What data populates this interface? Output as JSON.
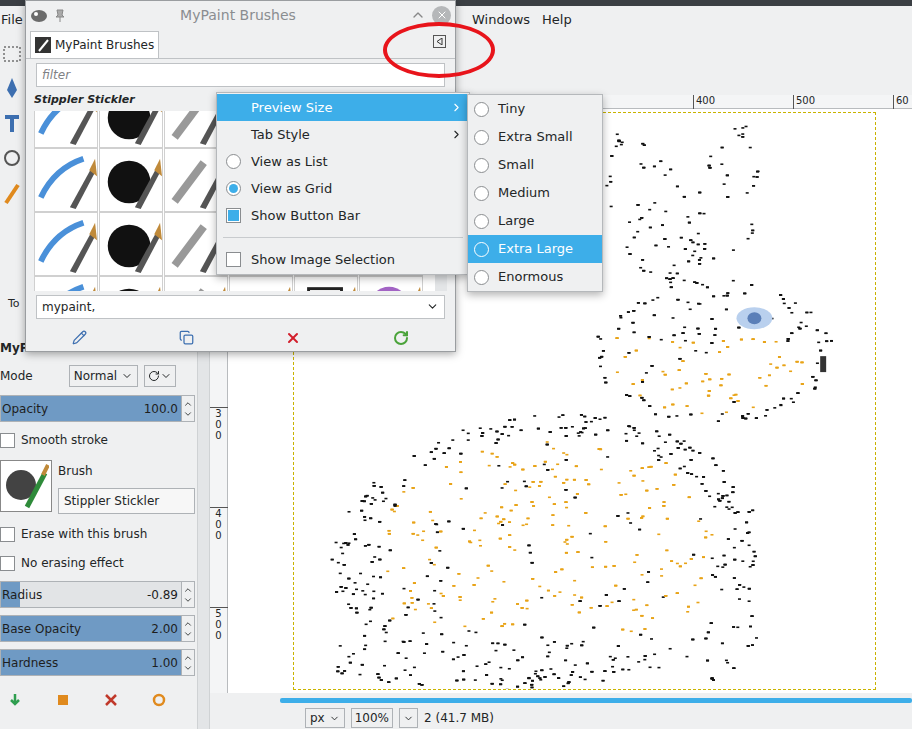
{
  "menubar": [
    {
      "label": "File"
    },
    {
      "label": "Windows"
    },
    {
      "label": "Help"
    }
  ],
  "dialog": {
    "title": "MyPaint Brushes",
    "tab": "MyPaint Brushes",
    "filter_placeholder": "filter",
    "brush_name": "Stippler Stickler",
    "tags": "mypaint,"
  },
  "context_menu": [
    {
      "label": "Preview Size",
      "kind": "submenu",
      "highlighted": true
    },
    {
      "label": "Tab Style",
      "kind": "submenu",
      "highlighted": false
    },
    {
      "label": "View as List",
      "kind": "radio",
      "selected": false,
      "highlighted": false
    },
    {
      "label": "View as Grid",
      "kind": "radio",
      "selected": true,
      "highlighted": false
    },
    {
      "label": "Show Button Bar",
      "kind": "check",
      "checked": true,
      "highlighted": false
    },
    {
      "label": "",
      "kind": "separator",
      "highlighted": false
    },
    {
      "label": "Show Image Selection",
      "kind": "check",
      "checked": false,
      "highlighted": false
    }
  ],
  "submenu": [
    {
      "label": "Tiny",
      "selected": false,
      "highlighted": false
    },
    {
      "label": "Extra Small",
      "selected": false,
      "highlighted": false
    },
    {
      "label": "Small",
      "selected": false,
      "highlighted": false
    },
    {
      "label": "Medium",
      "selected": false,
      "highlighted": false
    },
    {
      "label": "Large",
      "selected": false,
      "highlighted": false
    },
    {
      "label": "Extra Large",
      "selected": false,
      "highlighted": true
    },
    {
      "label": "Enormous",
      "selected": false,
      "highlighted": false
    }
  ],
  "tool_options": {
    "tab": "To",
    "title": "MyPa",
    "mode_label": "Mode",
    "mode": "Normal",
    "rows": [
      {
        "kind": "slider",
        "label": "Opacity",
        "value": "100.0",
        "level": 1
      },
      {
        "kind": "check",
        "label": "Smooth stroke",
        "checked": false
      },
      {
        "kind": "brush",
        "label": "Brush",
        "value": "Stippler Stickler"
      },
      {
        "kind": "check",
        "label": "Erase with this brush",
        "checked": false
      },
      {
        "kind": "check",
        "label": "No erasing effect",
        "checked": false
      },
      {
        "kind": "slider",
        "label": "Radius",
        "value": "-0.89",
        "level": 0.1
      },
      {
        "kind": "slider",
        "label": "Base Opacity",
        "value": "2.00",
        "level": 1
      },
      {
        "kind": "slider",
        "label": "Hardness",
        "value": "1.00",
        "level": 1
      }
    ]
  },
  "rulers": {
    "top": [
      "400",
      "500",
      "60"
    ],
    "left": [
      "300",
      "400",
      "500"
    ]
  },
  "status_bar": {
    "unit": "px",
    "zoom": "100%",
    "info": "2 (41.7 MB)"
  }
}
